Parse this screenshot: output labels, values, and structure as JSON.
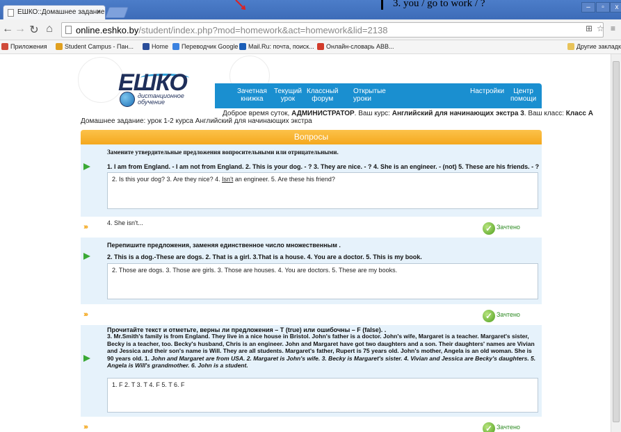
{
  "browser": {
    "tab_title": "ЕШКО::Домашнее задание",
    "tab_close": "×",
    "window_controls": {
      "minimize": "–",
      "maximize": "▫",
      "close": "x"
    },
    "url_host": "online.eshko.by",
    "url_path": "/student/index.php?mod=homework&act=homework&lid=2138",
    "bookmarks": [
      {
        "label": "Приложения",
        "color": "#d04a3a"
      },
      {
        "label": "Student Campus - Пан...",
        "color": "#e0a020"
      },
      {
        "label": "Home",
        "color": "#2a4e9a"
      },
      {
        "label": "Переводчик Google",
        "color": "#3b82e0"
      },
      {
        "label": "Mail.Ru: почта, поиск...",
        "color": "#1c5fb8"
      },
      {
        "label": "Онлайн-словарь ABB...",
        "color": "#d23b2b"
      }
    ],
    "other_bookmarks": "Другие закладки"
  },
  "overlay": {
    "note": "3.    you / go to work / ?"
  },
  "site": {
    "logo": {
      "name": "ЕШКО",
      "sub_line1": "дистанционное",
      "sub_line2": "обучение"
    },
    "nav": [
      {
        "label": "Зачетная\nкнижка"
      },
      {
        "label": "Текущий\nурок"
      },
      {
        "label": "Классный\nфорум"
      },
      {
        "label": "Открытые\nуроки"
      },
      {
        "label": "Настройки"
      },
      {
        "label": "Центр\nпомощи"
      }
    ],
    "greeting": {
      "prefix": "Доброе время суток, ",
      "user": "АДМИНИСТРАТОР",
      "course_prefix": ". Ваш курс: ",
      "course": "Английский для начинающих экстра 3",
      "class_prefix": ". Ваш класс: ",
      "class": "Класс А"
    },
    "homework_title": "Домашнее задание: урок 1-2 курса Английский для начинающих экстра",
    "questions_header": "Вопросы"
  },
  "questions": [
    {
      "instruction": "Замените утвердительные предложения вопросительными или отрицательными.",
      "task": "1. I am from England. - I am not from England. 2. This is your dog. - ? 3. They are nice. - ? 4. She is an engineer. - (not) 5. These are his friends. - ?",
      "answer_before": "2. Is this your dog? 3. Are they nice? 4. ",
      "answer_underlined": "Isn't",
      "answer_after": " an engineer. 5. Are these his friend?",
      "remark": "4. She isn't...",
      "status": "Зачтено"
    },
    {
      "instruction": "Перепишите предложения, заменяя единственное число множественным .",
      "task": "2. This is a dog.-These are dogs. 2. That is a girl. 3.That is a house. 4. You are  a doctor. 5. This is my book.",
      "answer": "2. Those are dogs. 3. Those are girls. 3. Those are houses. 4. You are doctors. 5. These are my books.",
      "status": "Зачтено"
    },
    {
      "instruction": "Прочитайте текст и отметьте, верны ли предложения – T (true) или ошибочны – F (false). .",
      "paragraph": "3. Mr.Smith's family is from England.  They live in a nice house in Bristol.  John's father is a doctor.  John's wife, Margaret is a teacher.  Margaret's sister, Becky is a teacher, too.  Becky's husband, Chris is an engineer.  John and Margaret have got two daughters and a son.  Their daughters' names are Vivian and Jessica and their son's name is Will.  They are all students.  Margaret's father, Rupert is 75 years old.  John's mother, Angela is an old woman.  She is 90 years old.  1. ",
      "statements": "John and Margaret are from USA.  2. Margaret is John's wife.  3. Becky is Margaret's sister.  4. Vivian and Jessica are Becky's daughters.  5. Angela is Will's grandmother.  6. John is a student.",
      "answer": "1. F 2. T 3. T 4. F 5. T 6. F",
      "status": "Зачтено"
    }
  ]
}
